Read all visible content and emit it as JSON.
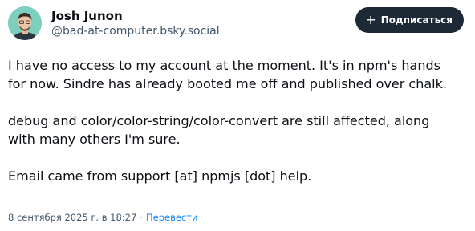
{
  "author": {
    "display_name": "Josh Junon",
    "handle": "@bad-at-computer.bsky.social"
  },
  "follow_button": {
    "icon": "plus-icon",
    "label": "Подписаться"
  },
  "post": {
    "paragraphs": [
      "I have no access to my account at the moment. It's in npm's hands for now. Sindre has already booted me off and published over chalk.",
      "debug and color/color-string/color-convert are still affected, along with many others I'm sure.",
      "Email came from support [at] npmjs [dot] help."
    ]
  },
  "meta": {
    "timestamp": "8 сентября 2025 г. в 18:27",
    "separator": "·",
    "translate_label": "Перевести"
  },
  "colors": {
    "button_bg": "#1e2936",
    "link": "#1083fe",
    "muted": "#42576c",
    "avatar_bg": "#7fcfc0"
  }
}
